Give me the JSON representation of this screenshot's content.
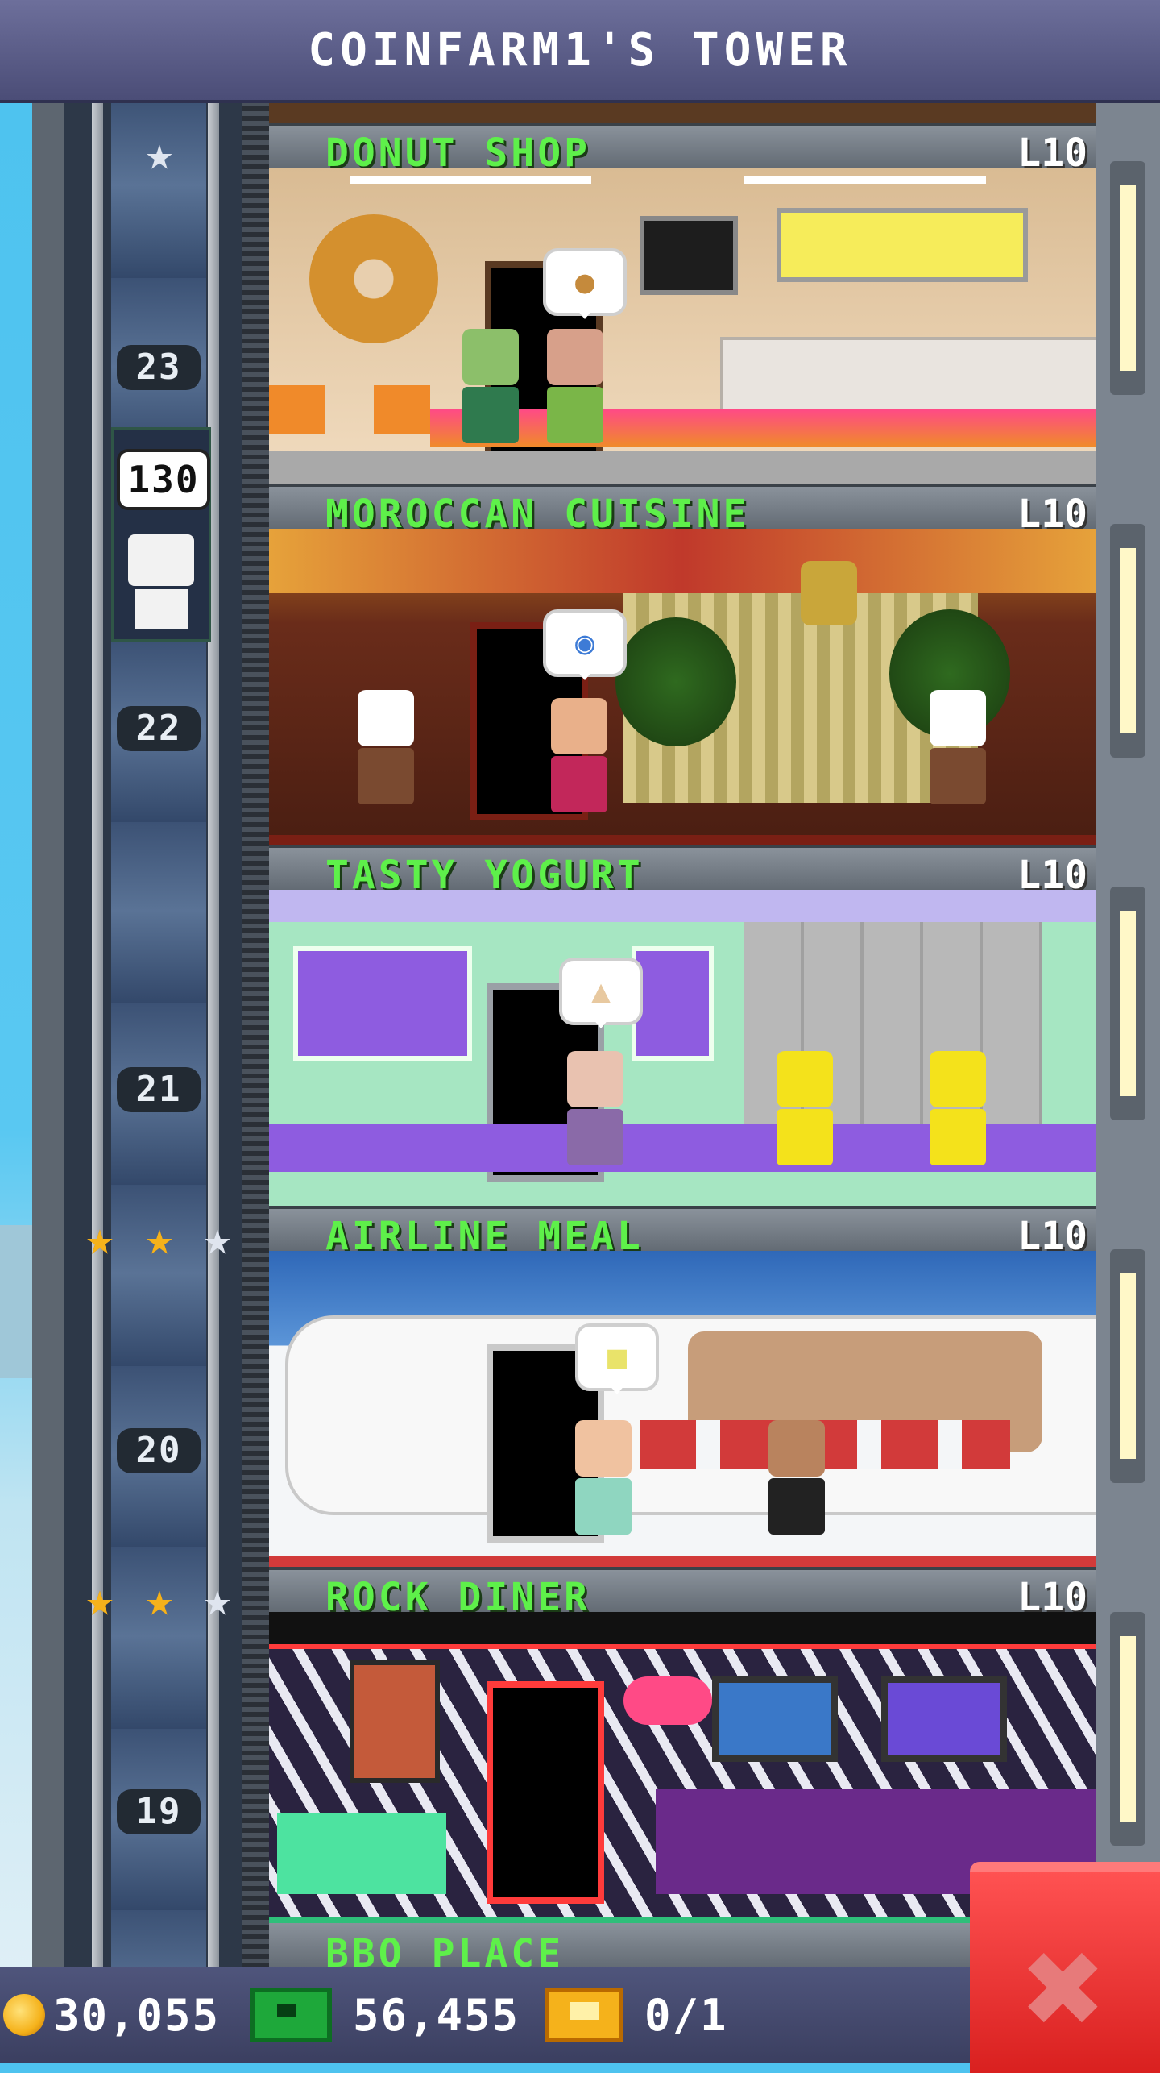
{
  "header": {
    "title": "COINFARM1'S TOWER"
  },
  "elevator": {
    "floor_labels": [
      "23",
      "22",
      "21",
      "20",
      "19"
    ],
    "passenger_count": "130",
    "top_floor_stars": [
      "silver"
    ]
  },
  "floors": [
    {
      "name": "DONUT SHOP",
      "level": "L10",
      "bubble_icon": "cookie-icon",
      "bg": "#e8cfae",
      "accent": "#f08a2a",
      "stars": []
    },
    {
      "name": "MOROCCAN CUISINE",
      "level": "L10",
      "bubble_icon": "plate-icon",
      "bg": "#6a2c1a",
      "accent": "#d9a33a",
      "stars": []
    },
    {
      "name": "TASTY YOGURT",
      "level": "L10",
      "bubble_icon": "yogurt-icon",
      "bg": "#a6e6c2",
      "accent": "#8e5ce0",
      "stars": [
        "gold",
        "gold",
        "silver"
      ]
    },
    {
      "name": "AIRLINE MEAL",
      "level": "L10",
      "bubble_icon": "meal-tray-icon",
      "bg": "#f4f6f8",
      "accent": "#3a78c8",
      "stars": [
        "gold",
        "gold",
        "silver"
      ]
    },
    {
      "name": "ROCK DINER",
      "level": "L10",
      "bubble_icon": "",
      "bg": "#2a2340",
      "accent": "#ff3b3b",
      "stars": []
    }
  ],
  "next_floor": {
    "name": "BBQ PLACE"
  },
  "resources": {
    "coins": "30,055",
    "bux": "56,455",
    "tickets": "0/1"
  },
  "colors": {
    "floor_name": "#5ef04a",
    "close_button": "#d9201f"
  }
}
